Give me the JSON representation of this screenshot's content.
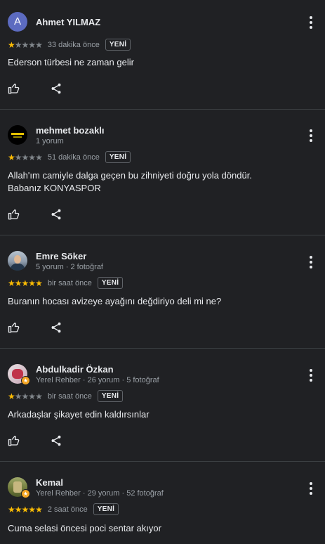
{
  "labels": {
    "new_badge": "YENİ"
  },
  "colors": {
    "background": "#202124",
    "star_on": "#fbbc04",
    "star_off": "#80868b",
    "text_secondary": "#9aa0a6"
  },
  "reviews": [
    {
      "name": "Ahmet YILMAZ",
      "avatar_letter": "A",
      "subtitle": "",
      "stars": 1,
      "time": "33 dakika önce",
      "text": "Ederson türbesi ne zaman gelir"
    },
    {
      "name": "mehmet bozaklı",
      "subtitle": "1 yorum",
      "stars": 1,
      "time": "51 dakika önce",
      "text": "Allah'ım camiyle dalga geçen bu zihniyeti doğru yola döndür.\nBabanız KONYASPOR"
    },
    {
      "name": "Emre Söker",
      "subtitle": "5 yorum · 2 fotoğraf",
      "stars": 5,
      "time": "bir saat önce",
      "text": "Buranın hocası avizeye ayağını değdiriyo deli mi ne?"
    },
    {
      "name": "Abdulkadir Özkan",
      "subtitle": "Yerel Rehber · 26 yorum · 5 fotoğraf",
      "stars": 1,
      "time": "bir saat önce",
      "text": "Arkadaşlar şikayet edin kaldırsınlar"
    },
    {
      "name": "Kemal",
      "subtitle": "Yerel Rehber · 29 yorum · 52 fotoğraf",
      "stars": 5,
      "time": "2 saat önce",
      "text": "Cuma selasi öncesi poci sentar akıyor"
    }
  ]
}
